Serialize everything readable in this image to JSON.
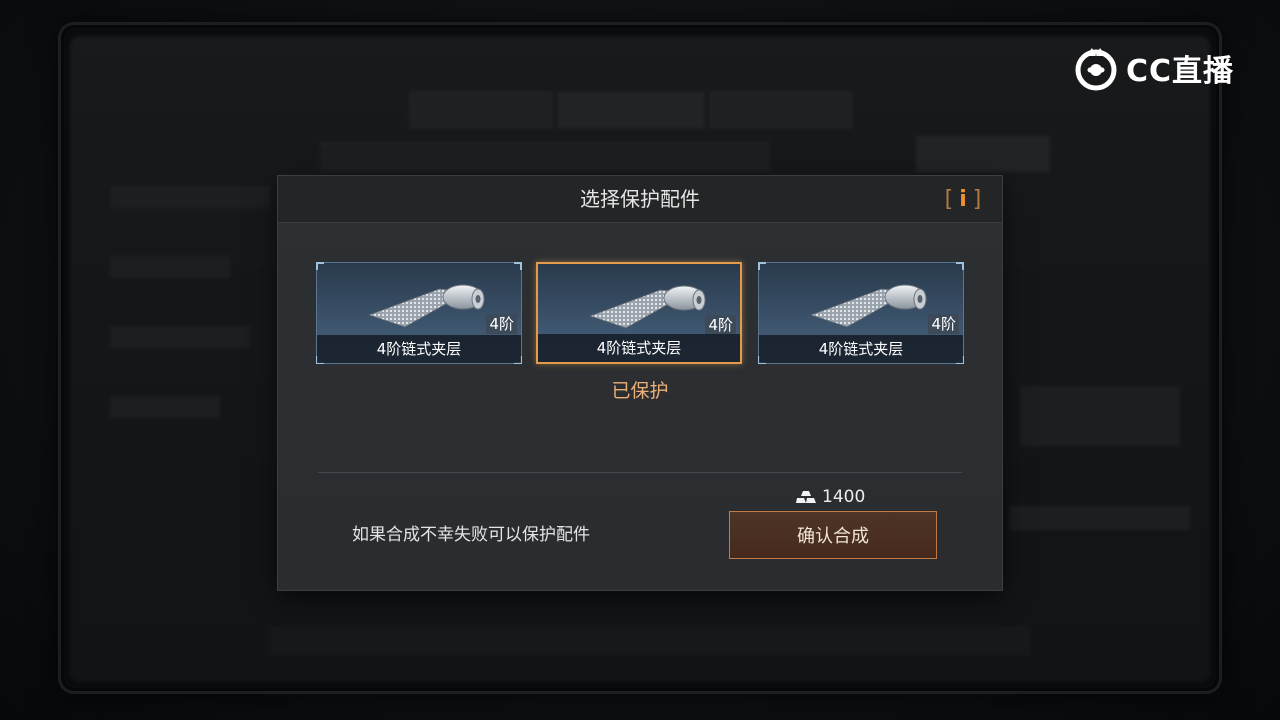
{
  "watermark": {
    "text": "CC直播",
    "icon": "cc-logo-icon"
  },
  "dialog": {
    "title": "选择保护配件",
    "info_icon": "info-icon",
    "info_label": "i",
    "cards": [
      {
        "name": "4阶链式夹层",
        "tier": "4阶",
        "selected": false,
        "icon": "chain-armor-roll-icon"
      },
      {
        "name": "4阶链式夹层",
        "tier": "4阶",
        "selected": true,
        "icon": "chain-armor-roll-icon"
      },
      {
        "name": "4阶链式夹层",
        "tier": "4阶",
        "selected": false,
        "icon": "chain-armor-roll-icon"
      }
    ],
    "status_text": "已保护",
    "hint_text": "如果合成不幸失败可以保护配件",
    "cost": {
      "icon": "gold-bars-icon",
      "amount": "1400"
    },
    "confirm_label": "确认合成"
  },
  "colors": {
    "accent": "#e39a4d",
    "card_bg": "#3a5169",
    "status": "#eab07a",
    "button_border": "#c07a45"
  }
}
